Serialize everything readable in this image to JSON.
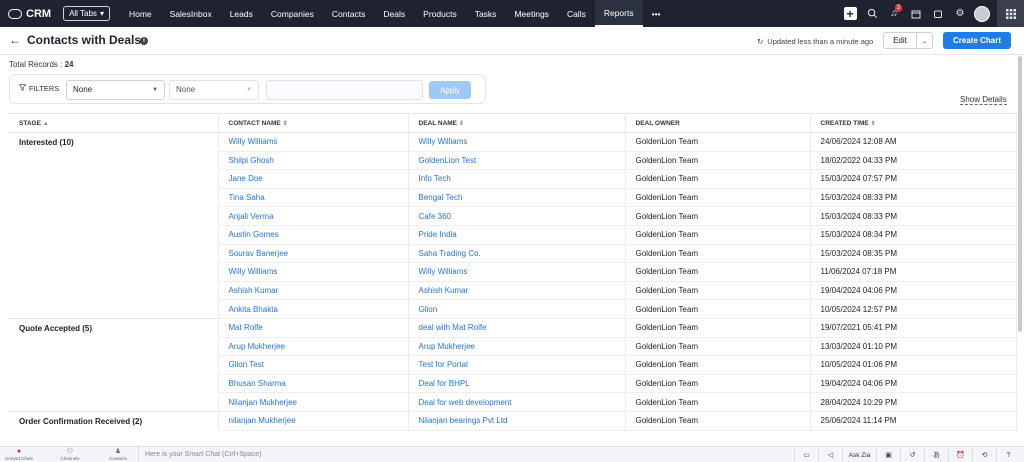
{
  "nav": {
    "brand": "CRM",
    "all_tabs": "All Tabs",
    "items": [
      "Home",
      "SalesInbox",
      "Leads",
      "Companies",
      "Contacts",
      "Deals",
      "Products",
      "Tasks",
      "Meetings",
      "Calls",
      "Reports"
    ],
    "active": "Reports",
    "more": "•••",
    "notification_count": "3"
  },
  "header": {
    "title": "Contacts with Deals",
    "updated": "Updated less than a minute ago",
    "edit_label": "Edit",
    "create_chart_label": "Create Chart"
  },
  "summary": {
    "label": "Total Records :",
    "count": "24"
  },
  "filters": {
    "title": "FILTERS",
    "select1": "None",
    "select2": "None",
    "apply_label": "Apply",
    "show_details": "Show Details"
  },
  "table": {
    "columns": [
      "STAGE",
      "CONTACT NAME",
      "DEAL NAME",
      "DEAL OWNER",
      "CREATED TIME"
    ],
    "groups": [
      {
        "stage": "Interested (10)",
        "rows": [
          [
            "Willy Williams",
            "Willy Williams",
            "GoldenLion Team",
            "24/06/2024 12:08 AM"
          ],
          [
            "Shilpi Ghosh",
            "GoldenLion Test",
            "GoldenLion Team",
            "18/02/2022 04:33 PM"
          ],
          [
            "Jane Doe",
            "Info Tech",
            "GoldenLion Team",
            "15/03/2024 07:57 PM"
          ],
          [
            "Tina Saha",
            "Bengal Tech",
            "GoldenLion Team",
            "15/03/2024 08:33 PM"
          ],
          [
            "Anjali Verma",
            "Cafe 360",
            "GoldenLion Team",
            "15/03/2024 08:33 PM"
          ],
          [
            "Austin Gomes",
            "Pride India",
            "GoldenLion Team",
            "15/03/2024 08:34 PM"
          ],
          [
            "Sourav Banerjee",
            "Saha Trading Co.",
            "GoldenLion Team",
            "15/03/2024 08:35 PM"
          ],
          [
            "Willy Williams",
            "Willy Williams",
            "GoldenLion Team",
            "11/06/2024 07:18 PM"
          ],
          [
            "Ashish Kumar",
            "Ashish Kumar",
            "GoldenLion Team",
            "19/04/2024 04:06 PM"
          ],
          [
            "Ankita Bhakta",
            "Glion",
            "GoldenLion Team",
            "10/05/2024 12:57 PM"
          ]
        ]
      },
      {
        "stage": "Quote Accepted (5)",
        "rows": [
          [
            "Mat Rolfe",
            "deal with Mat Rolfe",
            "GoldenLion Team",
            "19/07/2021 05:41 PM"
          ],
          [
            "Arup Mukherjee",
            "Arup Mukherjee",
            "GoldenLion Team",
            "13/03/2024 01:10 PM"
          ],
          [
            "Glion Test",
            "Test for Portal",
            "GoldenLion Team",
            "10/05/2024 01:06 PM"
          ],
          [
            "Bhusan Sharma",
            "Deal for BHPL",
            "GoldenLion Team",
            "19/04/2024 04:06 PM"
          ],
          [
            "Nilanjan Mukherjee",
            "Deal for web development",
            "GoldenLion Team",
            "28/04/2024 10:29 PM"
          ]
        ]
      },
      {
        "stage": "Order Confirmation Received (2)",
        "rows": [
          [
            "nilanjan Mukherjee",
            "Nilanjan bearings Pvt Ltd",
            "GoldenLion Team",
            "25/06/2024 11:14 PM"
          ]
        ]
      }
    ]
  },
  "bottom": {
    "items": [
      "Unread Chats",
      "Channels",
      "Contacts"
    ],
    "smart_chat_placeholder": "Here is your Smart Chat (Ctrl+Space)",
    "ask_zia": "Ask Zia"
  },
  "colors": {
    "nav_bg": "#1f2330",
    "primary": "#1e7de6",
    "link": "#2a73cc"
  }
}
